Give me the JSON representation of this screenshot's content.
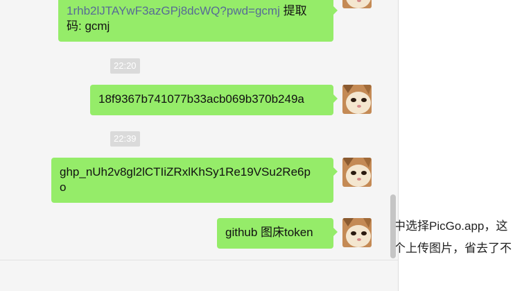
{
  "chat": {
    "messages": [
      {
        "link_text": "1rhb2lJTAYwF3azGPj8dcWQ?pwd=gcmj",
        "text_after": " 提取",
        "text_line2": "码: gcmj"
      },
      {
        "timestamp": "22:20",
        "text": "18f9367b741077b33acb069b370b249a"
      },
      {
        "timestamp": "22:39",
        "text_line1": "ghp_nUh2v8gl2lCTIiZRxlKhSy1Re19VSu2Re6p",
        "text_line2": "o"
      },
      {
        "text": "github 图床token"
      }
    ]
  },
  "article": {
    "line1": "中选择PicGo.app，这",
    "line2": "个上传图片，省去了不"
  },
  "colors": {
    "bubble": "#95ec69",
    "link": "#576b95",
    "chat_bg": "#f5f5f5",
    "timestamp_bg": "#dadada"
  }
}
